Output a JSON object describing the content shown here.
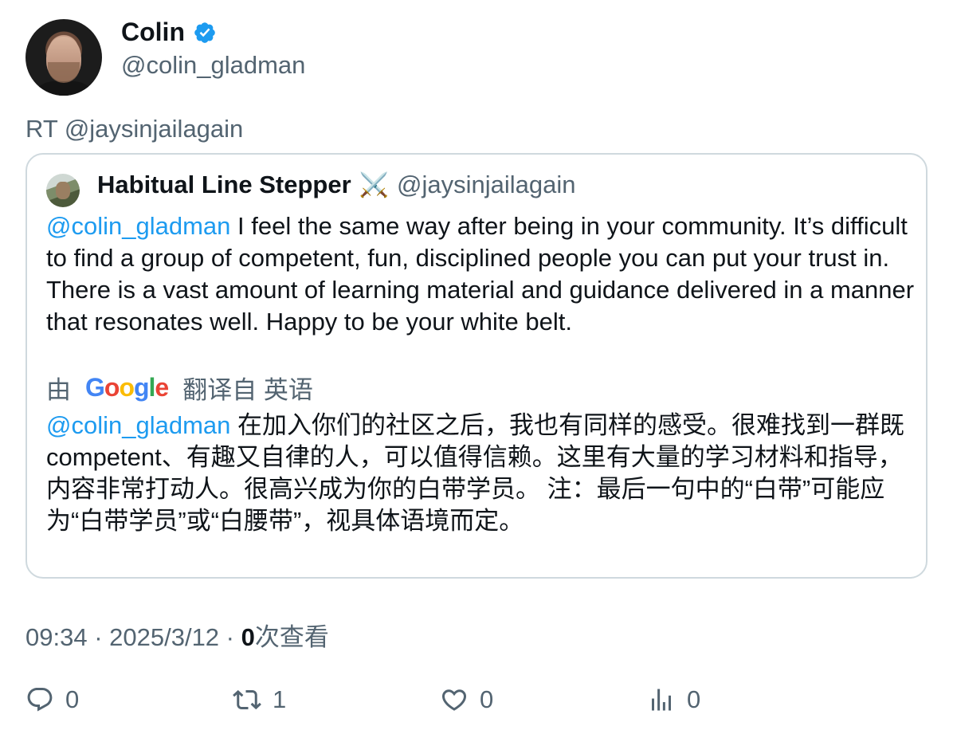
{
  "author": {
    "display_name": "Colin",
    "handle": "@colin_gladman",
    "verified_icon": "verified-badge-icon",
    "verified_color": "#1d9bf0"
  },
  "retweet_label": "RT @jaysinjailagain",
  "quoted": {
    "display_name": "Habitual Line Stepper",
    "emoji": "⚔️",
    "handle": "@jaysinjailagain",
    "mention": "@colin_gladman",
    "text": " I feel the same way after being in your community. It’s difficult to find a group of competent, fun, disciplined people you can put your trust in. There is a vast amount of learning material and guidance delivered in a manner that resonates well. Happy to be your white belt.",
    "translate": {
      "prefix": "由",
      "provider_letters": [
        "G",
        "o",
        "o",
        "g",
        "l",
        "e"
      ],
      "suffix": "翻译自 英语"
    },
    "translated_mention": "@colin_gladman",
    "translated_text": " 在加入你们的社区之后，我也有同样的感受。很难找到一群既 competent、有趣又自律的人，可以值得信赖。这里有大量的学习材料和指导，内容非常打动人。很高兴成为你的白带学员。 注：最后一句中的“白带”可能应为“白带学员”或“白腰带”，视具体语境而定。"
  },
  "meta": {
    "time": "09:34",
    "sep1": " · ",
    "date": "2025/3/12",
    "sep2": " · ",
    "views_count": "0",
    "views_label": "次查看"
  },
  "actions": {
    "reply": {
      "icon": "reply-icon",
      "count": "0"
    },
    "retweet": {
      "icon": "retweet-icon",
      "count": "1"
    },
    "like": {
      "icon": "heart-icon",
      "count": "0"
    },
    "views": {
      "icon": "analytics-icon",
      "count": "0"
    }
  },
  "colors": {
    "text": "#0f1419",
    "secondary": "#536471",
    "link": "#1d9bf0",
    "border": "#cfd9de"
  }
}
